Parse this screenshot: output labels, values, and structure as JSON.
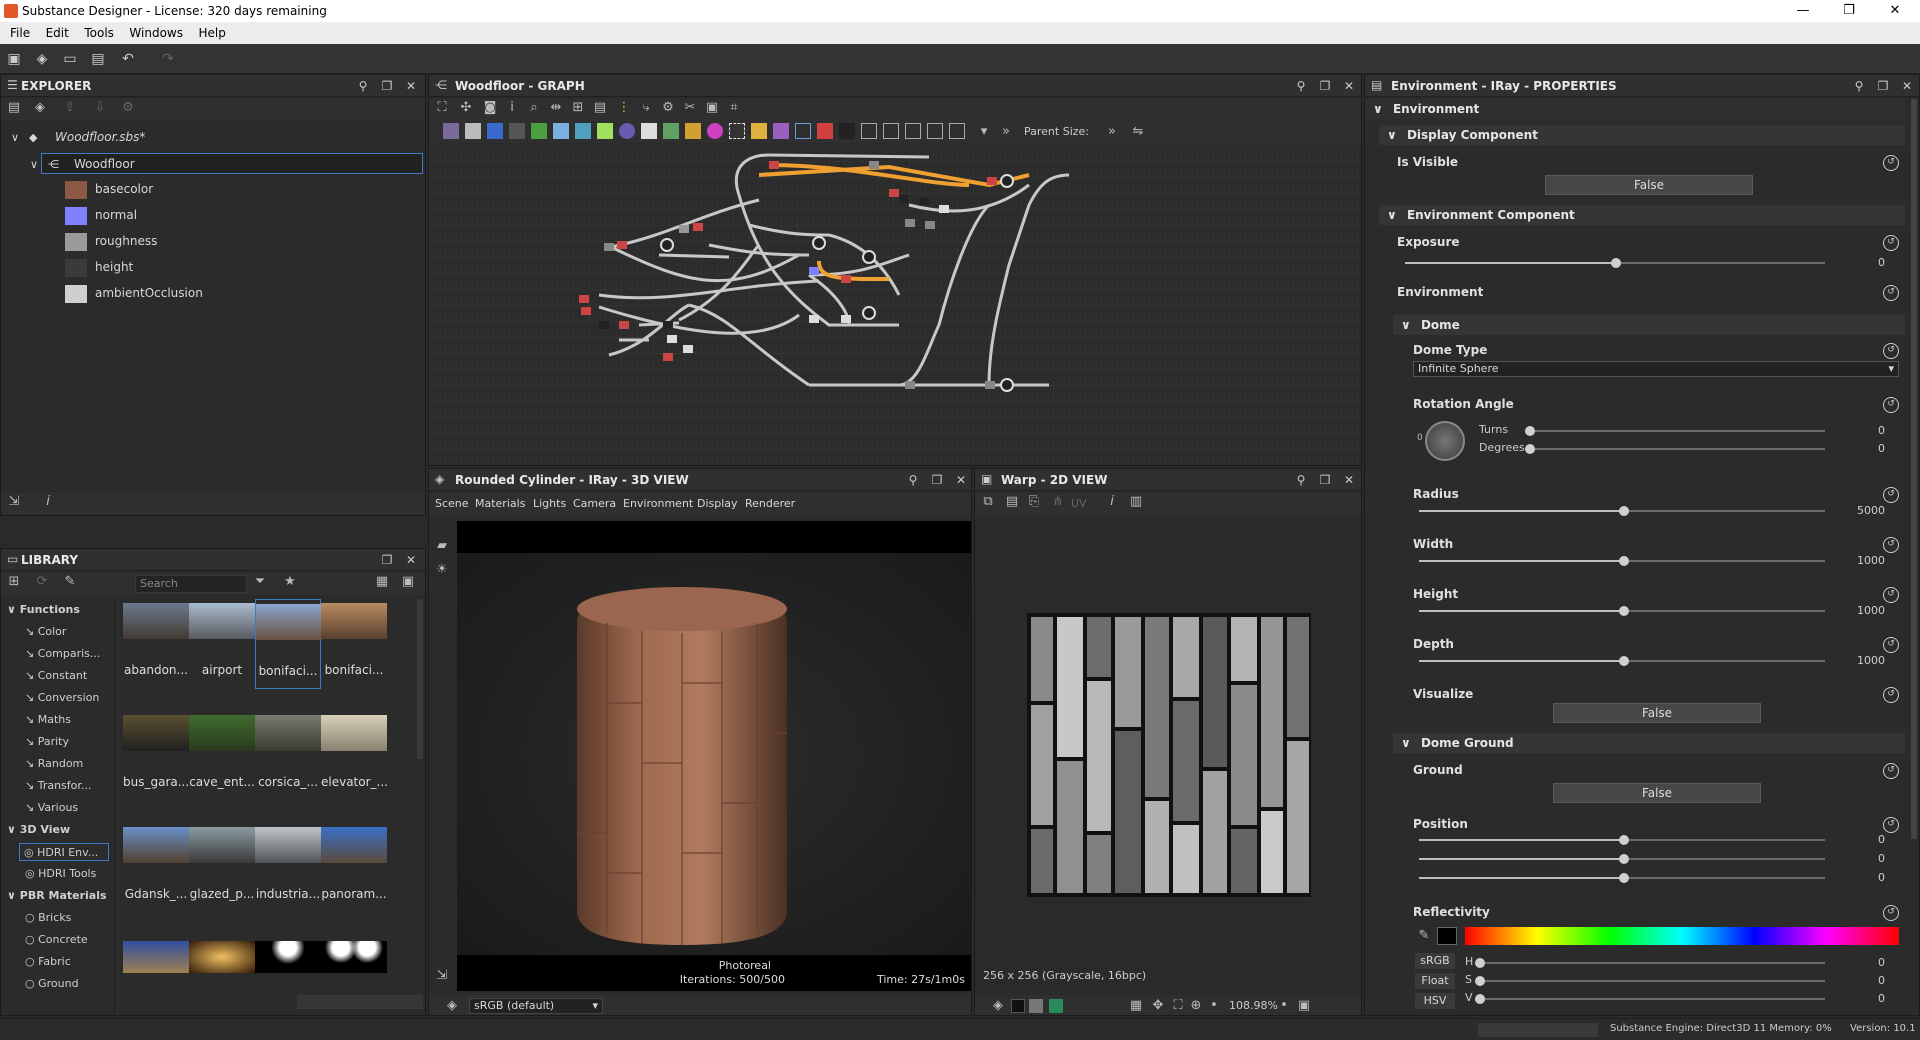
{
  "window": {
    "title": "Substance Designer - License: 320 days remaining",
    "minimize": "—",
    "maximize": "❐",
    "close": "✕"
  },
  "menu": [
    "File",
    "Edit",
    "Tools",
    "Windows",
    "Help"
  ],
  "explorer": {
    "title": "EXPLORER",
    "package": "Woodfloor.sbs*",
    "graph": "Woodfloor",
    "outputs": [
      {
        "label": "basecolor",
        "color": "#8a5a44"
      },
      {
        "label": "normal",
        "color": "#8080ff"
      },
      {
        "label": "roughness",
        "color": "#9a9a9a"
      },
      {
        "label": "height",
        "color": "#3a3a3a"
      },
      {
        "label": "ambientOcclusion",
        "color": "#cfcfcf"
      }
    ]
  },
  "graph": {
    "title": "Woodfloor - GRAPH",
    "parent_size_label": "Parent Size:",
    "edge_color": "#c8c8c8",
    "highlight_color": "#f0a030"
  },
  "library": {
    "title": "LIBRARY",
    "search_placeholder": "Search",
    "categories": [
      {
        "label": "Functions",
        "expanded": true,
        "items": [
          "Color",
          "Comparis...",
          "Constant",
          "Conversion",
          "Maths",
          "Parity",
          "Random",
          "Transfor...",
          "Various"
        ]
      },
      {
        "label": "3D View",
        "expanded": true,
        "items": [
          "HDRI Env...",
          "HDRI Tools"
        ]
      },
      {
        "label": "PBR Materials",
        "expanded": true,
        "items": [
          "Bricks",
          "Concrete",
          "Fabric",
          "Ground"
        ]
      }
    ],
    "thumbnails": [
      "abandon...",
      "airport",
      "bonifaci...",
      "bonifaci...",
      "bus_gara...",
      "cave_ent...",
      "corsica_...",
      "elevator_...",
      "Gdansk_...",
      "glazed_p...",
      "industria...",
      "panoram..."
    ]
  },
  "view3d": {
    "title": "Rounded Cylinder - IRay - 3D VIEW",
    "menu": [
      "Scene",
      "Materials",
      "Lights",
      "Camera",
      "Environment",
      "Display",
      "Renderer"
    ],
    "render_mode": "Photoreal",
    "iterations": "Iterations: 500/500",
    "time": "Time: 27s/1m0s",
    "colorspace": "sRGB (default)"
  },
  "view2d": {
    "title": "Warp - 2D VIEW",
    "uv_label": "UV",
    "info": "256 x 256 (Grayscale, 16bpc)",
    "zoom": "108.98%"
  },
  "properties": {
    "title": "Environment - IRay - PROPERTIES",
    "root": "Environment",
    "display_component": "Display Component",
    "is_visible_label": "Is Visible",
    "is_visible_value": "False",
    "env_component": "Environment Component",
    "exposure_label": "Exposure",
    "exposure_value": "0",
    "environment_label": "Environment",
    "dome_section": "Dome",
    "dome_type_label": "Dome Type",
    "dome_type_value": "Infinite Sphere",
    "rotation_label": "Rotation Angle",
    "turns_label": "Turns",
    "turns_value": "0",
    "degrees_label": "Degrees",
    "degrees_value": "0",
    "dial_zero": "0",
    "radius_label": "Radius",
    "radius_value": "5000",
    "width_label": "Width",
    "width_value": "1000",
    "height_label": "Height",
    "height_value": "1000",
    "depth_label": "Depth",
    "depth_value": "1000",
    "visualize_label": "Visualize",
    "visualize_value": "False",
    "dome_ground": "Dome Ground",
    "ground_label": "Ground",
    "ground_value": "False",
    "position_label": "Position",
    "position_values": [
      "0",
      "0",
      "0"
    ],
    "reflectivity_label": "Reflectivity",
    "srgb": "sRGB",
    "float": "Float",
    "hsv": "HSV",
    "h": "H",
    "s": "S",
    "v": "V",
    "hsv_values": [
      "0",
      "0",
      "0"
    ]
  },
  "status": {
    "engine": "Substance Engine: Direct3D 11  Memory: 0%",
    "version": "Version: 10.1"
  }
}
